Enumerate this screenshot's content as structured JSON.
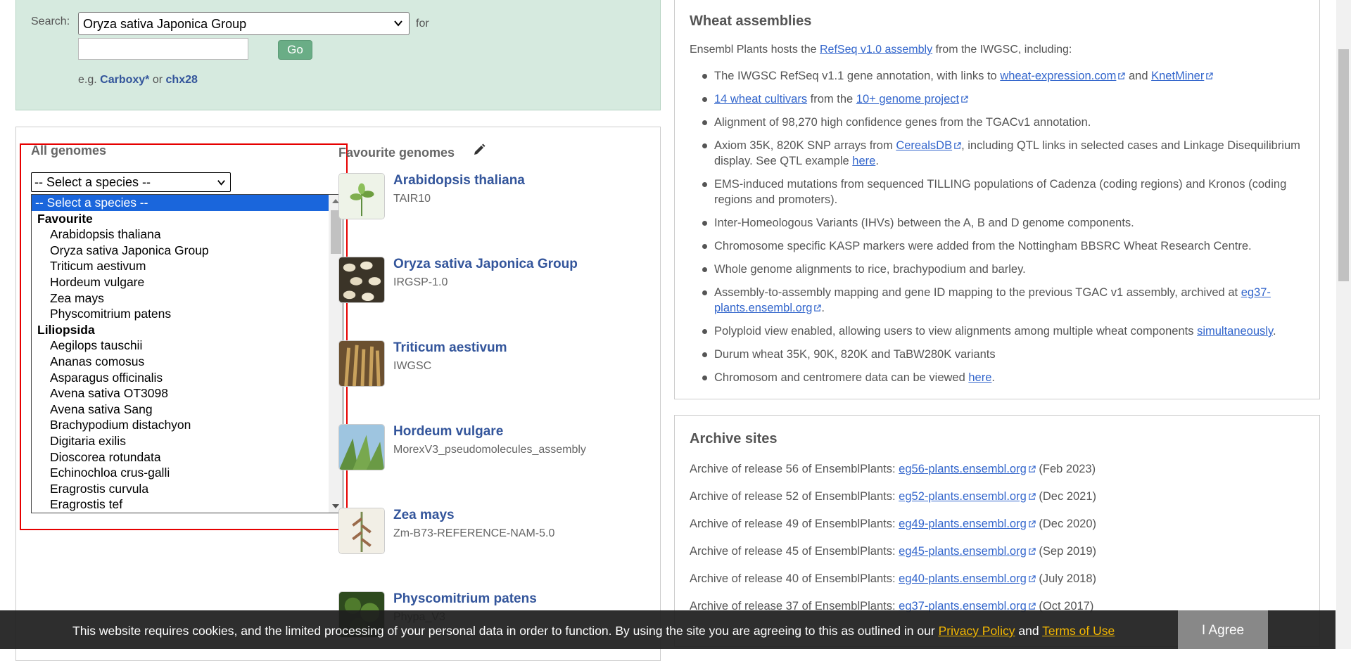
{
  "search": {
    "label": "Search:",
    "species_selected": "Oryza sativa Japonica Group",
    "for_label": "for",
    "query_value": "",
    "go_label": "Go",
    "examples_prefix": "e.g.",
    "example1": "Carboxy*",
    "examples_or": "or",
    "example2": "chx28"
  },
  "all_genomes": {
    "title": "All genomes",
    "select_value": "-- Select a species --",
    "dropdown": [
      {
        "kind": "selected",
        "label": "-- Select a species --"
      },
      {
        "kind": "group",
        "label": "Favourite"
      },
      {
        "kind": "opt",
        "label": "Arabidopsis thaliana"
      },
      {
        "kind": "opt",
        "label": "Oryza sativa Japonica Group"
      },
      {
        "kind": "opt",
        "label": "Triticum aestivum"
      },
      {
        "kind": "opt",
        "label": "Hordeum vulgare"
      },
      {
        "kind": "opt",
        "label": "Zea mays"
      },
      {
        "kind": "opt",
        "label": "Physcomitrium patens"
      },
      {
        "kind": "group",
        "label": "Liliopsida"
      },
      {
        "kind": "opt",
        "label": "Aegilops tauschii"
      },
      {
        "kind": "opt",
        "label": "Ananas comosus"
      },
      {
        "kind": "opt",
        "label": "Asparagus officinalis"
      },
      {
        "kind": "opt",
        "label": "Avena sativa OT3098"
      },
      {
        "kind": "opt",
        "label": "Avena sativa Sang"
      },
      {
        "kind": "opt",
        "label": "Brachypodium distachyon"
      },
      {
        "kind": "opt",
        "label": "Digitaria exilis"
      },
      {
        "kind": "opt",
        "label": "Dioscorea rotundata"
      },
      {
        "kind": "opt",
        "label": "Echinochloa crus-galli"
      },
      {
        "kind": "opt",
        "label": "Eragrostis curvula"
      },
      {
        "kind": "opt",
        "label": "Eragrostis tef"
      }
    ]
  },
  "favourites": {
    "title": "Favourite genomes",
    "items": [
      {
        "name": "Arabidopsis thaliana",
        "assembly": "TAIR10"
      },
      {
        "name": "Oryza sativa Japonica Group",
        "assembly": "IRGSP-1.0"
      },
      {
        "name": "Triticum aestivum",
        "assembly": "IWGSC"
      },
      {
        "name": "Hordeum vulgare",
        "assembly": "MorexV3_pseudomolecules_assembly"
      },
      {
        "name": "Zea mays",
        "assembly": "Zm-B73-REFERENCE-NAM-5.0"
      },
      {
        "name": "Physcomitrium patens",
        "assembly": "Phypa_V3"
      }
    ]
  },
  "wheat": {
    "title": "Wheat assemblies",
    "intro_pre": "Ensembl Plants hosts the",
    "intro_link": "RefSeq v1.0 assembly",
    "intro_post": "from the IWGSC, including:",
    "items": {
      "i1_pre": "The IWGSC RefSeq v1.1 gene annotation, with links to",
      "i1_link1": "wheat-expression.com",
      "i1_and": "and",
      "i1_link2": "KnetMiner",
      "i2_link1": "14 wheat cultivars",
      "i2_mid": "from the",
      "i2_link2": "10+ genome project",
      "i3": "Alignment of 98,270 high confidence genes from the TGACv1 annotation.",
      "i4_pre": "Axiom 35K, 820K SNP arrays from",
      "i4_link": "CerealsDB",
      "i4_post": ", including QTL links in selected cases and Linkage Disequilibrium display. See QTL example",
      "i4_link2": "here",
      "i5": "EMS-induced mutations from sequenced TILLING populations of Cadenza (coding regions) and Kronos (coding regions and promoters).",
      "i6": "Inter-Homeologous Variants (IHVs) between the A, B and D genome components.",
      "i7": "Chromosome specific KASP markers were added from the Nottingham BBSRC Wheat Research Centre.",
      "i8": "Whole genome alignments to rice, brachypodium and barley.",
      "i9_pre": "Assembly-to-assembly mapping and gene ID mapping to the previous TGAC v1 assembly, archived at",
      "i9_link": "eg37-plants.ensembl.org",
      "i10_pre": "Polyploid view enabled, allowing users to view alignments among multiple wheat components",
      "i10_link": "simultaneously",
      "i11": "Durum wheat 35K, 90K, 820K and TaBW280K variants",
      "i12_pre": "Chromosom and centromere data can be viewed",
      "i12_link": "here"
    }
  },
  "archive": {
    "title": "Archive sites",
    "rows": [
      {
        "label": "Archive of release 56 of EnsemblPlants:",
        "link": "eg56-plants.ensembl.org",
        "date": "(Feb 2023)"
      },
      {
        "label": "Archive of release 52 of EnsemblPlants:",
        "link": "eg52-plants.ensembl.org",
        "date": "(Dec 2021)"
      },
      {
        "label": "Archive of release 49 of EnsemblPlants:",
        "link": "eg49-plants.ensembl.org",
        "date": "(Dec 2020)"
      },
      {
        "label": "Archive of release 45 of EnsemblPlants:",
        "link": "eg45-plants.ensembl.org",
        "date": "(Sep 2019)"
      },
      {
        "label": "Archive of release 40 of EnsemblPlants:",
        "link": "eg40-plants.ensembl.org",
        "date": "(July 2018)"
      },
      {
        "label": "Archive of release 37 of EnsemblPlants:",
        "link": "eg37-plants.ensembl.org",
        "date": "(Oct 2017)"
      }
    ]
  },
  "cookie": {
    "text": "This website requires cookies, and the limited processing of your personal data in order to function. By using the site you are agreeing to this as outlined in our",
    "privacy": "Privacy Policy",
    "and": "and",
    "terms": "Terms of Use",
    "agree": "I Agree"
  },
  "colors": {
    "search_panel_bg": "#d6eadf",
    "link": "#3366cc",
    "species_link": "#33559b",
    "go_button": "#6aad86",
    "selection_blue": "#1a66dc",
    "highlight_red": "#e60000",
    "cookie_link": "#f5b800"
  }
}
